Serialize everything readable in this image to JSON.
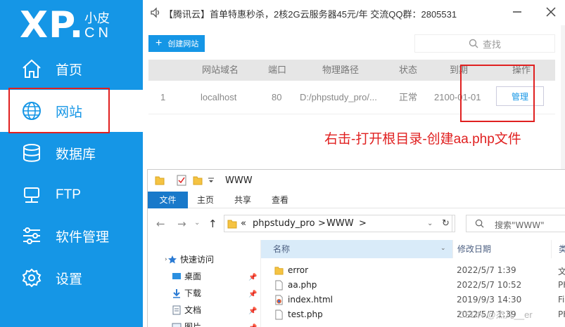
{
  "logo": {
    "main": "XP.",
    "small": "小皮",
    "domain": "CN"
  },
  "sidebar": {
    "items": [
      {
        "label": "首页",
        "icon": "home-icon"
      },
      {
        "label": "网站",
        "icon": "globe-icon"
      },
      {
        "label": "数据库",
        "icon": "database-icon"
      },
      {
        "label": "FTP",
        "icon": "server-icon"
      },
      {
        "label": "软件管理",
        "icon": "sliders-icon"
      },
      {
        "label": "设置",
        "icon": "gear-icon"
      }
    ]
  },
  "ad": {
    "text": "【腾讯云】首单特惠秒杀，2核2G云服务器45元/年 交流QQ群：2805531"
  },
  "toolbar": {
    "create_label": "创建网站",
    "search_placeholder": "查找"
  },
  "table": {
    "headers": [
      "网站域名",
      "端口",
      "物理路径",
      "状态",
      "到期",
      "操作"
    ],
    "rows": [
      {
        "index": "1",
        "domain": "localhost",
        "port": "80",
        "path": "D:/phpstudy_pro/...",
        "status": "正常",
        "expire": "2100-01-01",
        "action": "管理"
      }
    ]
  },
  "annotation": "右击-打开根目录-创建aa.php文件",
  "explorer": {
    "title": "WWW",
    "tabs": [
      "文件",
      "主页",
      "共享",
      "查看"
    ],
    "breadcrumb": [
      "«",
      "phpstudy_pro",
      ">",
      "WWW",
      ">"
    ],
    "search_placeholder": "搜索\"WWW\"",
    "nav": [
      "快速访问",
      "桌面",
      "下载",
      "文档",
      "图片"
    ],
    "columns": {
      "name": "名称",
      "date": "修改日期",
      "type": "类"
    },
    "files": [
      {
        "name": "error",
        "date": "2022/5/7 1:39",
        "type": "文",
        "kind": "folder"
      },
      {
        "name": "aa.php",
        "date": "2022/5/7 10:52",
        "type": "PH",
        "kind": "php"
      },
      {
        "name": "index.html",
        "date": "2019/9/3 14:30",
        "type": "Fir",
        "kind": "html"
      },
      {
        "name": "test.php",
        "date": "2022/5/7 1:39",
        "type": "PH",
        "kind": "php"
      }
    ]
  },
  "watermark": "CSDN @杰儿__er",
  "colors": {
    "brand_blue": "#1596e6",
    "annotation_red": "#e02020",
    "folder_yellow": "#f5c342"
  }
}
